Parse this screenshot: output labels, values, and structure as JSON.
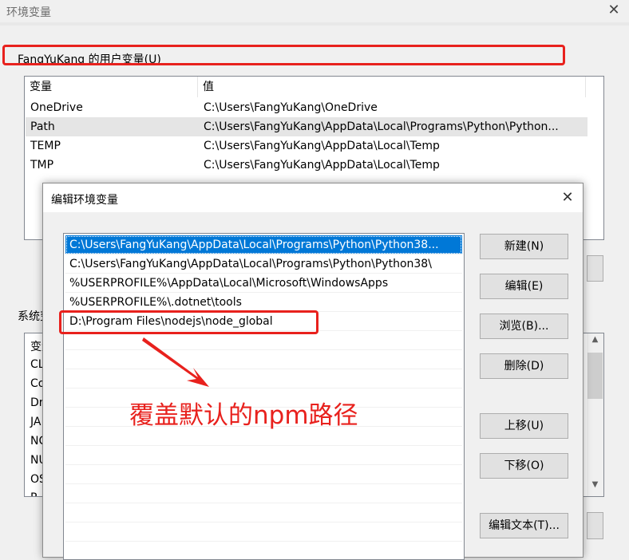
{
  "window": {
    "title": "环境变量",
    "close_glyph": "✕"
  },
  "user_vars": {
    "group_label": "FangYuKang 的用户变量(U)",
    "col_name": "变量",
    "col_value": "值",
    "rows": [
      {
        "name": "OneDrive",
        "value": "C:\\Users\\FangYuKang\\OneDrive"
      },
      {
        "name": "Path",
        "value": "C:\\Users\\FangYuKang\\AppData\\Local\\Programs\\Python\\Python..."
      },
      {
        "name": "TEMP",
        "value": "C:\\Users\\FangYuKang\\AppData\\Local\\Temp"
      },
      {
        "name": "TMP",
        "value": "C:\\Users\\FangYuKang\\AppData\\Local\\Temp"
      }
    ]
  },
  "system_vars": {
    "group_label": "系统变",
    "rows": [
      "变量",
      "CL",
      "Co",
      "Dr",
      "JA",
      "NC",
      "NU",
      "OS",
      "P"
    ]
  },
  "dialog": {
    "title": "编辑环境变量",
    "close_glyph": "✕",
    "paths": [
      "C:\\Users\\FangYuKang\\AppData\\Local\\Programs\\Python\\Python38...",
      "C:\\Users\\FangYuKang\\AppData\\Local\\Programs\\Python\\Python38\\",
      "%USERPROFILE%\\AppData\\Local\\Microsoft\\WindowsApps",
      "%USERPROFILE%\\.dotnet\\tools",
      "D:\\Program Files\\nodejs\\node_global"
    ],
    "buttons": {
      "new": "新建(N)",
      "edit": "编辑(E)",
      "browse": "浏览(B)...",
      "delete": "删除(D)",
      "move_up": "上移(U)",
      "move_down": "下移(O)",
      "edit_text": "编辑文本(T)..."
    }
  },
  "annotation": {
    "text": "覆盖默认的npm路径",
    "color": "#e8211d"
  },
  "colors": {
    "selection": "#0078d7",
    "highlight": "#e8211d",
    "window_bg": "#f0f0f0"
  },
  "icons": {
    "scroll_up": "▲",
    "scroll_down": "▼"
  }
}
